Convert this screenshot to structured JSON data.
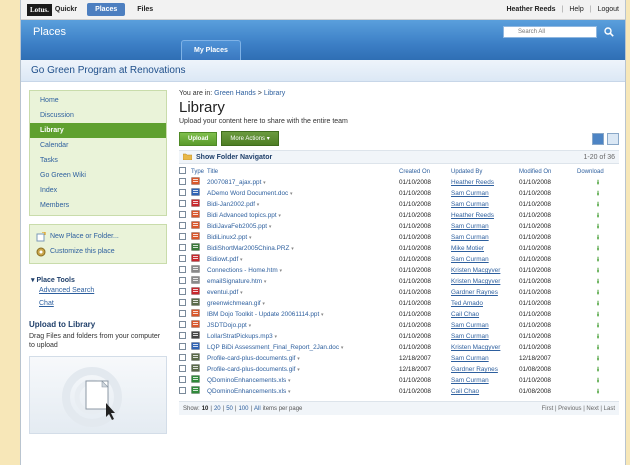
{
  "topbar": {
    "brand_logo": "Lotus.",
    "brand_name": "Quickr",
    "tabs": [
      {
        "label": "Places",
        "active": true
      },
      {
        "label": "Files",
        "active": false
      }
    ],
    "user": "Heather Reeds",
    "help": "Help",
    "logout": "Logout"
  },
  "banner": {
    "title": "Places",
    "tab": "My Places",
    "search_placeholder": "Search All"
  },
  "place": {
    "title": "Go Green Program at Renovations"
  },
  "nav": {
    "items": [
      {
        "label": "Home",
        "active": false
      },
      {
        "label": "Discussion",
        "active": false
      },
      {
        "label": "Library",
        "active": true
      },
      {
        "label": "Calendar",
        "active": false
      },
      {
        "label": "Tasks",
        "active": false
      },
      {
        "label": "Go Green Wiki",
        "active": false
      },
      {
        "label": "Index",
        "active": false
      },
      {
        "label": "Members",
        "active": false
      }
    ],
    "actions": {
      "new_place": "New Place or Folder...",
      "customize": "Customize this place"
    },
    "tools_title": "Place Tools",
    "tools": [
      "Advanced Search",
      "Chat"
    ],
    "upload_title": "Upload to Library",
    "upload_text": "Drag Files and folders from your computer to upload"
  },
  "main": {
    "crumb_prefix": "You are in:",
    "crumb_place": "Green Hands",
    "crumb_sep": ">",
    "crumb_current": "Library",
    "title": "Library",
    "description": "Upload your content here to share with the entire team",
    "upload_button": "Upload",
    "more_actions": "More Actions",
    "folder_nav": "Show Folder Navigator",
    "count": "1-20 of 36",
    "columns": {
      "type": "Type",
      "title": "Title",
      "created": "Created On",
      "updated_by": "Updated By",
      "modified": "Modified On",
      "download": "Download"
    },
    "pager": {
      "show": "Show:",
      "sizes": [
        "10",
        "20",
        "50",
        "100",
        "All"
      ],
      "current": "10",
      "items_per_page": "items per page",
      "nav": "First | Previous | Next | Last"
    }
  },
  "files": [
    {
      "title": "20070817_ajax.ppt",
      "type": "ppt",
      "created": "01/10/2008",
      "updated_by": "Heather Reeds",
      "modified": "01/10/2008"
    },
    {
      "title": "ADemo Word Document.doc",
      "type": "doc",
      "created": "01/10/2008",
      "updated_by": "Sam Curman",
      "modified": "01/10/2008"
    },
    {
      "title": "Bidi-Jan2002.pdf",
      "type": "pdf",
      "created": "01/10/2008",
      "updated_by": "Sam Curman",
      "modified": "01/10/2008"
    },
    {
      "title": "Bidi Advanced topics.ppt",
      "type": "ppt",
      "created": "01/10/2008",
      "updated_by": "Heather Reeds",
      "modified": "01/10/2008"
    },
    {
      "title": "BidiJavaFeb2005.ppt",
      "type": "ppt",
      "created": "01/10/2008",
      "updated_by": "Sam Curman",
      "modified": "01/10/2008"
    },
    {
      "title": "BidiLinux2.ppt",
      "type": "ppt",
      "created": "01/10/2008",
      "updated_by": "Sam Curman",
      "modified": "01/10/2008"
    },
    {
      "title": "BidiShortMar2005China.PRZ",
      "type": "prz",
      "created": "01/10/2008",
      "updated_by": "Mike Motier",
      "modified": "01/10/2008"
    },
    {
      "title": "Bidiowt.pdf",
      "type": "pdf",
      "created": "01/10/2008",
      "updated_by": "Sam Curman",
      "modified": "01/10/2008"
    },
    {
      "title": "Connections - Home.htm",
      "type": "htm",
      "created": "01/10/2008",
      "updated_by": "Kristen Macgyver",
      "modified": "01/10/2008"
    },
    {
      "title": "emailSignature.htm",
      "type": "htm",
      "created": "01/10/2008",
      "updated_by": "Kristen Macgyver",
      "modified": "01/10/2008"
    },
    {
      "title": "eventui.pdf",
      "type": "pdf",
      "created": "01/10/2008",
      "updated_by": "Gardner Raynes",
      "modified": "01/10/2008"
    },
    {
      "title": "greenwichmean.gif",
      "type": "gif",
      "created": "01/10/2008",
      "updated_by": "Ted Amado",
      "modified": "01/10/2008"
    },
    {
      "title": "IBM Dojo Toolkit - Update 20061114.ppt",
      "type": "ppt",
      "created": "01/10/2008",
      "updated_by": "Cail Chao",
      "modified": "01/10/2008"
    },
    {
      "title": "JSDTDojo.ppt",
      "type": "ppt",
      "created": "01/10/2008",
      "updated_by": "Sam Curman",
      "modified": "01/10/2008"
    },
    {
      "title": "LollarStratPickups.mp3",
      "type": "mp3",
      "created": "01/10/2008",
      "updated_by": "Sam Curman",
      "modified": "01/10/2008"
    },
    {
      "title": "LQP BiDi Assessment_Final_Report_2Jan.doc",
      "type": "doc",
      "created": "01/10/2008",
      "updated_by": "Kristen Macgyver",
      "modified": "01/10/2008"
    },
    {
      "title": "Profile-card-plus-documents.gif",
      "type": "gif",
      "created": "12/18/2007",
      "updated_by": "Sam Curman",
      "modified": "12/18/2007"
    },
    {
      "title": "Profile-card-plus-documents.gif",
      "type": "gif",
      "created": "12/18/2007",
      "updated_by": "Gardner Raynes",
      "modified": "01/08/2008"
    },
    {
      "title": "QDominoEnhancements.xls",
      "type": "xls",
      "created": "01/10/2008",
      "updated_by": "Sam Curman",
      "modified": "01/10/2008"
    },
    {
      "title": "QDominoEnhancements.xls",
      "type": "xls",
      "created": "01/10/2008",
      "updated_by": "Cail Chao",
      "modified": "01/08/2008"
    }
  ],
  "colors": {
    "banner": "#3c7fc6",
    "nav_active": "#5fa02f",
    "link": "#2d5f9e",
    "ppt": "#d9572b",
    "doc": "#2f63b5",
    "pdf": "#c8272d",
    "xls": "#2f8a3a",
    "gif": "#5a6a4a",
    "htm": "#8a8a8a",
    "mp3": "#444444",
    "prz": "#3a7a3a"
  }
}
